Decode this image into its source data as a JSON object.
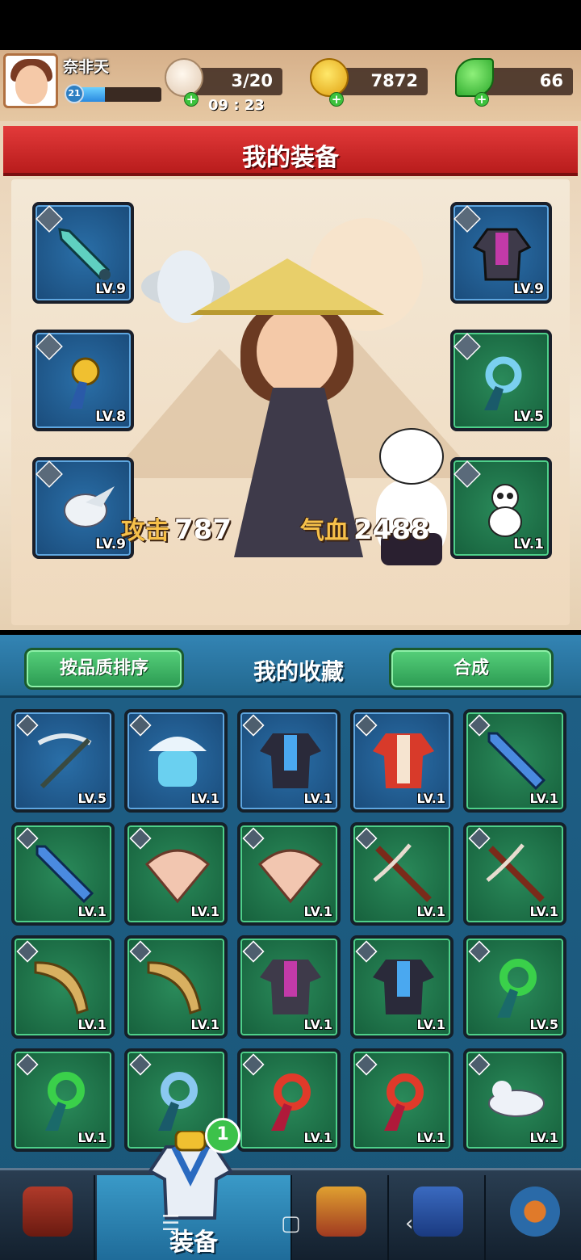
{
  "player": {
    "name": "奈非天",
    "level": "21",
    "xp_fraction": 0.35
  },
  "resources": {
    "stamina": {
      "value": "3/20",
      "icon": "bun-icon"
    },
    "gold": {
      "value": "7872",
      "icon": "gold-leaf-icon"
    },
    "jade": {
      "value": "66",
      "icon": "green-leaf-icon"
    },
    "timer": "09 : 23"
  },
  "equip_panel": {
    "title": "我的装备",
    "slots": [
      {
        "name": "dagger",
        "level": "LV.9",
        "color": "blue",
        "type": "weapon"
      },
      {
        "name": "robe",
        "level": "LV.9",
        "color": "blue",
        "type": "armor"
      },
      {
        "name": "golden-pendant",
        "level": "LV.8",
        "color": "blue",
        "type": "accessory"
      },
      {
        "name": "jade-ring-pendant",
        "level": "LV.5",
        "color": "green",
        "type": "accessory"
      },
      {
        "name": "white-bird-pet",
        "level": "LV.9",
        "color": "blue",
        "type": "pet"
      },
      {
        "name": "panda-pet",
        "level": "LV.1",
        "color": "green",
        "type": "pet"
      }
    ],
    "attack_label": "攻击",
    "attack_value": "787",
    "hp_label": "气血",
    "hp_value": "2488"
  },
  "collection": {
    "title": "我的收藏",
    "sort_label": "按品质排序",
    "merge_label": "合成",
    "items": [
      {
        "item": "crossbow",
        "level": "LV.5",
        "color": "blue"
      },
      {
        "item": "snow-hat",
        "level": "LV.1",
        "color": "blue"
      },
      {
        "item": "blue-robe",
        "level": "LV.1",
        "color": "blue"
      },
      {
        "item": "red-robe",
        "level": "LV.1",
        "color": "blue"
      },
      {
        "item": "blue-sword",
        "level": "LV.1",
        "color": "green"
      },
      {
        "item": "blue-sword",
        "level": "LV.1",
        "color": "green"
      },
      {
        "item": "fan",
        "level": "LV.1",
        "color": "green"
      },
      {
        "item": "fan",
        "level": "LV.1",
        "color": "green"
      },
      {
        "item": "red-crossbow",
        "level": "LV.1",
        "color": "green"
      },
      {
        "item": "red-crossbow",
        "level": "LV.1",
        "color": "green"
      },
      {
        "item": "golden-blade",
        "level": "LV.1",
        "color": "green"
      },
      {
        "item": "golden-blade",
        "level": "LV.1",
        "color": "green"
      },
      {
        "item": "dark-robe",
        "level": "LV.1",
        "color": "green"
      },
      {
        "item": "blue-robe",
        "level": "LV.1",
        "color": "green"
      },
      {
        "item": "jade-pendant",
        "level": "LV.5",
        "color": "green"
      },
      {
        "item": "jade-pendant",
        "level": "LV.1",
        "color": "green"
      },
      {
        "item": "silver-pendant",
        "level": "LV.1",
        "color": "green"
      },
      {
        "item": "phoenix-pendant",
        "level": "LV.1",
        "color": "green"
      },
      {
        "item": "phoenix-pendant",
        "level": "LV.1",
        "color": "green"
      },
      {
        "item": "ferret-pet",
        "level": "LV.1",
        "color": "green"
      }
    ]
  },
  "bottom_nav": {
    "active_label": "装备",
    "badge_count": "1",
    "tabs": [
      "shop",
      "equipment",
      "skills",
      "book",
      "settings"
    ]
  },
  "colors": {
    "banner_red": "#d62a2a",
    "button_green": "#3cb864",
    "rare_blue": "#1a4b7a",
    "common_green": "#16603c"
  }
}
